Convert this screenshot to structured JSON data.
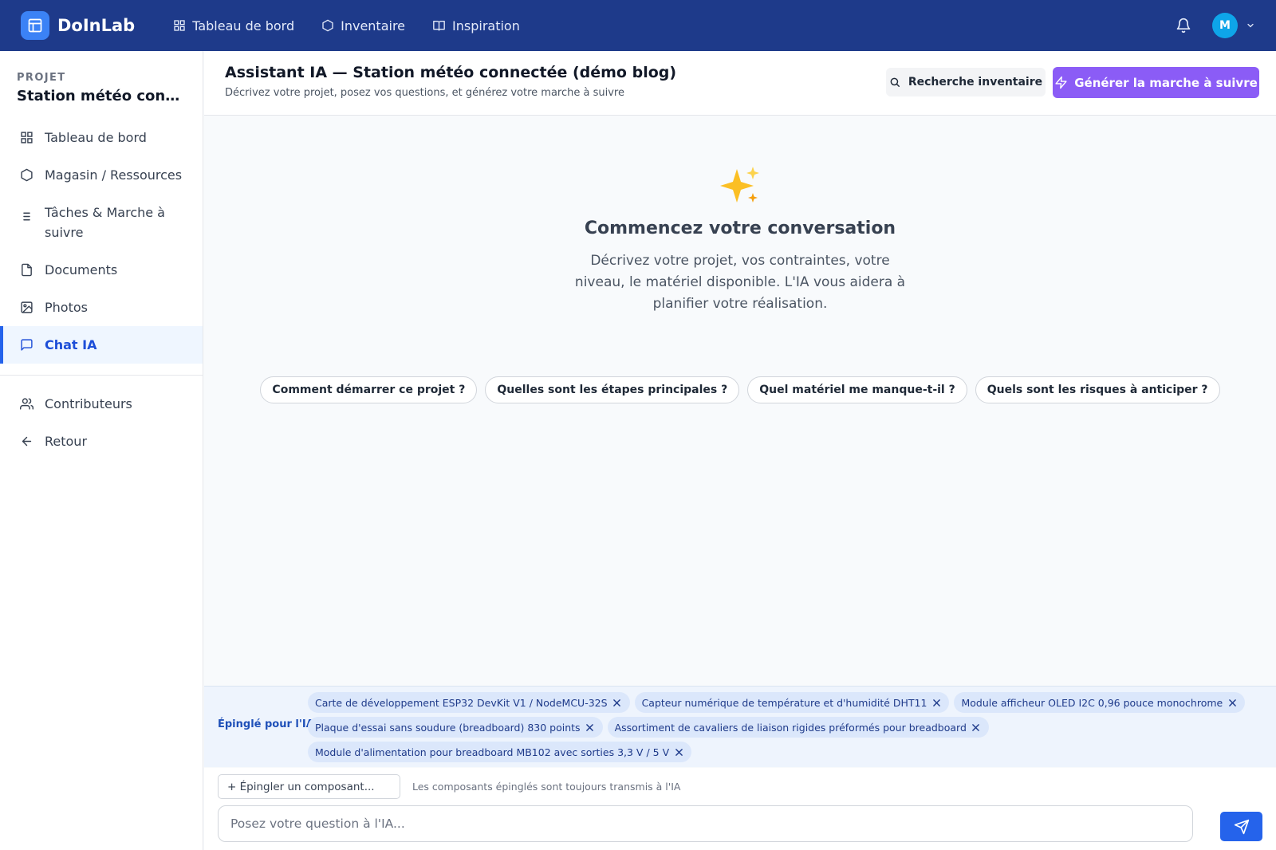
{
  "app": {
    "name": "DoInLab"
  },
  "topnav": [
    {
      "label": "Tableau de bord",
      "icon": "grid-icon"
    },
    {
      "label": "Inventaire",
      "icon": "box-icon"
    },
    {
      "label": "Inspiration",
      "icon": "book-icon"
    }
  ],
  "user": {
    "initial": "M"
  },
  "sidebar": {
    "project_label": "PROJET",
    "project_name": "Station météo connectée (démo blog)",
    "items": [
      {
        "label": "Tableau de bord",
        "icon": "grid-icon"
      },
      {
        "label": "Magasin / Ressources",
        "icon": "box-icon"
      },
      {
        "label": "Tâches & Marche à suivre",
        "icon": "list-icon"
      },
      {
        "label": "Documents",
        "icon": "document-icon"
      },
      {
        "label": "Photos",
        "icon": "image-icon"
      },
      {
        "label": "Chat IA",
        "icon": "chat-icon",
        "active": true
      }
    ],
    "bottom_items": [
      {
        "label": "Contributeurs",
        "icon": "users-icon"
      },
      {
        "label": "Retour",
        "icon": "arrow-left-icon"
      }
    ]
  },
  "header": {
    "title": "Assistant IA — Station météo connectée (démo blog)",
    "subtitle": "Décrivez votre projet, posez vos questions, et générez votre marche à suivre",
    "search_button": "Recherche inventaire",
    "generate_button": "Générer la marche à suivre"
  },
  "empty_state": {
    "emoji": "✨",
    "title": "Commencez votre conversation",
    "description": "Décrivez votre projet, vos contraintes, votre niveau, le matériel disponible. L'IA vous aidera à planifier votre réalisation.",
    "suggestions": [
      "Comment démarrer ce projet ?",
      "Quelles sont les étapes principales ?",
      "Quel matériel me manque-t-il ?",
      "Quels sont les risques à anticiper ?"
    ]
  },
  "pinned": {
    "label": "Épinglé pour l'IA :",
    "rows": [
      [
        "Carte de développement ESP32 DevKit V1 / NodeMCU-32S",
        "Capteur numérique de température et d'humidité DHT11",
        "Module afficheur OLED I2C 0,96 pouce monochrome"
      ],
      [
        "Plaque d'essai sans soudure (breadboard) 830 points",
        "Assortiment de cavaliers de liaison rigides préformés pour breadboard"
      ],
      [
        "Module d'alimentation pour breadboard MB102 avec sorties 3,3 V / 5 V"
      ]
    ]
  },
  "composer": {
    "pin_button": "+ Épingler un composant...",
    "pin_hint": "Les composants épinglés sont toujours transmis à l'IA",
    "input_value": "",
    "input_placeholder": "Posez votre question à l'IA..."
  },
  "colors": {
    "topbar": "#1e3a8a",
    "accent": "#2563eb",
    "generate": "#8b5cf6",
    "pinned_bg": "#eef4fd"
  }
}
